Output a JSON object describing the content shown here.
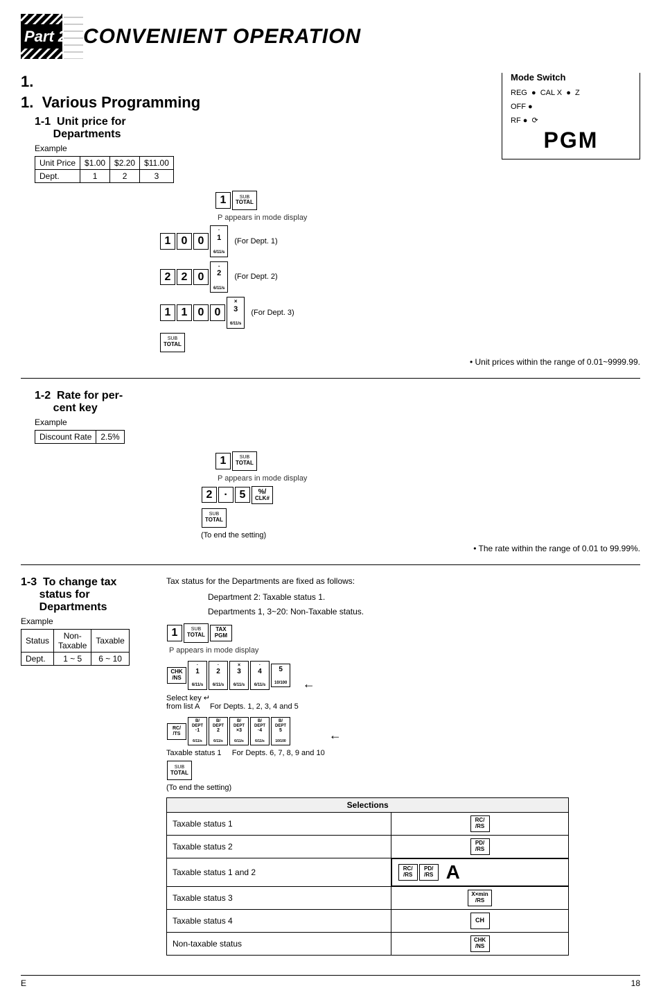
{
  "header": {
    "part": "Part 2",
    "title": "CONVENIENT OPERATION"
  },
  "section1": {
    "number": "1.",
    "title": "Various Programming",
    "sub1": {
      "number": "1-1",
      "title": "Unit price for\nDepartments",
      "example_label": "Example",
      "table": {
        "headers": [
          "Unit Price",
          "$1.00",
          "$2.20",
          "$11.00"
        ],
        "row": [
          "Dept.",
          "1",
          "2",
          "3"
        ]
      },
      "appears_text": "P appears in mode display",
      "for_dept": [
        "(For Dept. 1)",
        "(For Dept. 2)",
        "(For Dept. 3)"
      ],
      "note": "• Unit prices within the range of 0.01~9999.99."
    },
    "sub2": {
      "number": "1-2",
      "title": "Rate for per-\ncent key",
      "example_label": "Example",
      "table": {
        "headers": [
          "Discount Rate",
          "2.5%"
        ]
      },
      "appears_text": "P appears in mode display",
      "to_end": "(To end the setting)",
      "note": "• The rate within the range of 0.01 to 99.99%."
    },
    "sub3": {
      "number": "1-3",
      "title": "To change tax\nstatus for\nDepartments",
      "example_label": "Example",
      "tax_info_line1": "Tax status for the Departments are fixed as follows:",
      "tax_info_dept2": "Department 2:          Taxable status 1.",
      "tax_info_depts": "Departments 1, 3~20:  Non-Taxable status.",
      "table": {
        "headers": [
          "Status",
          "Non-\nTaxable",
          "Taxable"
        ],
        "row": [
          "Dept.",
          "1 ~ 5",
          "6 ~ 10"
        ]
      },
      "appears_text": "P appears in mode display",
      "select_key_label": "Select key",
      "from_list_A": "from list A",
      "for_depts_1_5": "For Depts. 1, 2, 3, 4 and 5",
      "taxable_status_1": "Taxable status 1",
      "for_depts_6_10": "For Depts. 6, 7, 8, 9 and 10",
      "to_end": "(To end the setting)",
      "selections_header": "Selections",
      "selections": [
        {
          "label": "Taxable status 1",
          "key": "RC"
        },
        {
          "label": "Taxable status 2",
          "key": "PD"
        },
        {
          "label": "Taxable status 1 and 2",
          "key": "RC PD"
        },
        {
          "label": "Taxable status 3",
          "key": "X×min"
        },
        {
          "label": "Taxable status 4",
          "key": "CH"
        },
        {
          "label": "Non-taxable status",
          "key": "CHK"
        }
      ]
    }
  },
  "mode_switch": {
    "title": "Mode Switch",
    "options": [
      "REG",
      "CAL X",
      "Z",
      "OFF",
      "RF",
      "PGM"
    ],
    "pgm": "PGM"
  },
  "footer": {
    "left": "E",
    "right": "18"
  }
}
